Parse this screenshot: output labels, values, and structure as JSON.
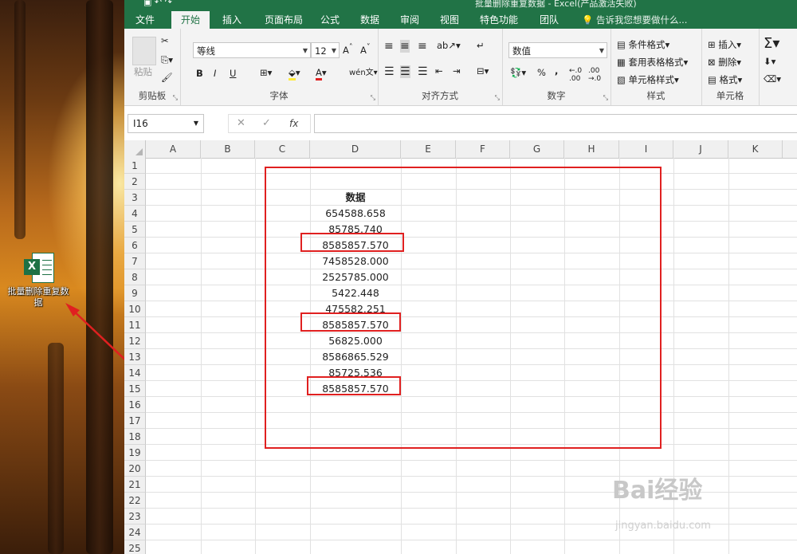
{
  "desktop": {
    "icon_label": "批量删除重复数据"
  },
  "window": {
    "title": "批量删除重复数据 - Excel(产品激活失败)"
  },
  "menu": {
    "tabs": [
      "文件",
      "开始",
      "插入",
      "页面布局",
      "公式",
      "数据",
      "审阅",
      "视图",
      "特色功能",
      "团队"
    ],
    "active": "开始",
    "tell_me": "告诉我您想要做什么..."
  },
  "ribbon": {
    "clipboard": {
      "label": "剪贴板",
      "paste": "粘贴"
    },
    "font": {
      "label": "字体",
      "name": "等线",
      "size": "12",
      "bold": "B",
      "italic": "I",
      "underline": "U"
    },
    "alignment": {
      "label": "对齐方式"
    },
    "number": {
      "label": "数字",
      "format": "数值"
    },
    "styles": {
      "label": "样式",
      "conditional": "条件格式",
      "table": "套用表格格式",
      "cell": "单元格样式"
    },
    "cells": {
      "label": "单元格",
      "insert": "插入",
      "delete": "删除",
      "format": "格式"
    }
  },
  "formula_bar": {
    "name_box": "I16",
    "fx": "fx",
    "value": ""
  },
  "sheet": {
    "columns": [
      "A",
      "B",
      "C",
      "D",
      "E",
      "F",
      "G",
      "H",
      "I",
      "J",
      "K"
    ],
    "rows": [
      "1",
      "2",
      "3",
      "4",
      "5",
      "6",
      "7",
      "8",
      "9",
      "10",
      "11",
      "12",
      "13",
      "14",
      "15",
      "16",
      "17",
      "18",
      "19",
      "20",
      "21",
      "22",
      "23",
      "24",
      "25"
    ],
    "header_cell": "数据",
    "values": [
      "654588.658",
      "85785.740",
      "8585857.570",
      "7458528.000",
      "2525785.000",
      "5422.448",
      "475582.251",
      "8585857.570",
      "56825.000",
      "8586865.529",
      "85725.536",
      "8585857.570"
    ]
  },
  "watermark": {
    "brand": "Bai经验",
    "url": "jingyan.baidu.com"
  },
  "annotation_color": "#e02020",
  "accent": "#217346"
}
